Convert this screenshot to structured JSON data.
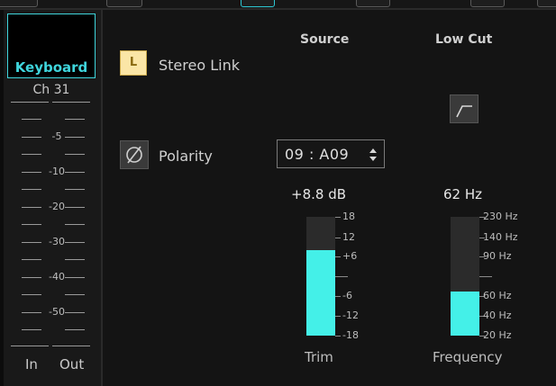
{
  "channel": {
    "name": "Keyboard",
    "number": "Ch 31",
    "meter_scale": [
      "-5",
      "-10",
      "-20",
      "-30",
      "-40",
      "-50"
    ],
    "meter_labels": {
      "in": "In",
      "out": "Out"
    }
  },
  "headers": {
    "source": "Source",
    "low_cut": "Low Cut"
  },
  "stereo_link": {
    "button_text": "L",
    "label": "Stereo Link"
  },
  "polarity": {
    "label": "Polarity"
  },
  "source_select": {
    "value": "09 : A09"
  },
  "trim": {
    "readout": "+8.8 dB",
    "scale": [
      "18",
      "12",
      "+6",
      "-6",
      "-12",
      "-18"
    ],
    "label": "Trim",
    "level_fraction": 0.72,
    "fill_color": "#44f0e8"
  },
  "frequency": {
    "readout": "62 Hz",
    "scale": [
      "230 Hz",
      "140 Hz",
      "90 Hz",
      "60 Hz",
      "40 Hz",
      "20 Hz"
    ],
    "label": "Frequency",
    "level_fraction": 0.37,
    "fill_color": "#44f0e8"
  },
  "colors": {
    "accent": "#3fd5dc",
    "link_button": "#fbe6a6"
  }
}
